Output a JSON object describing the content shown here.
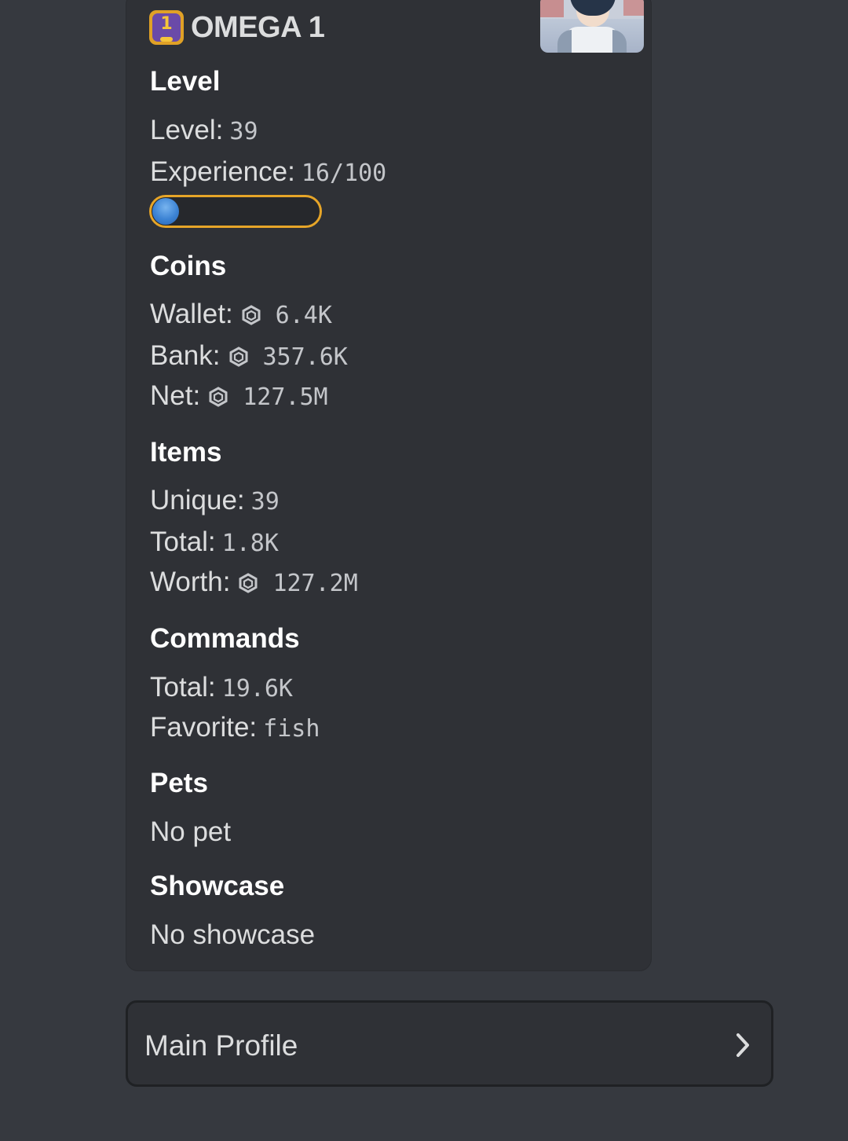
{
  "embed": {
    "title": "OMEGA 1",
    "badge_digit": "1",
    "thumbnail": "avatar-thumbnail",
    "sections": {
      "level": {
        "heading": "Level",
        "level_label": "Level:",
        "level_value": "39",
        "experience_label": "Experience:",
        "experience_value": "16/100",
        "experience_progress": 0.16
      },
      "coins": {
        "heading": "Coins",
        "wallet_label": "Wallet:",
        "wallet_value": "6.4K",
        "bank_label": "Bank:",
        "bank_value": "357.6K",
        "net_label": "Net:",
        "net_value": "127.5M",
        "coin_icon": "coin-icon"
      },
      "items": {
        "heading": "Items",
        "unique_label": "Unique:",
        "unique_value": "39",
        "total_label": "Total:",
        "total_value": "1.8K",
        "worth_label": "Worth:",
        "worth_value": "127.2M"
      },
      "commands": {
        "heading": "Commands",
        "total_label": "Total:",
        "total_value": "19.6K",
        "favorite_label": "Favorite:",
        "favorite_value": "fish"
      },
      "pets": {
        "heading": "Pets",
        "text": "No pet"
      },
      "showcase": {
        "heading": "Showcase",
        "text": "No showcase"
      }
    }
  },
  "select_menu": {
    "label": "Main Profile",
    "icon": "chevron-right-icon"
  },
  "colors": {
    "background": "#36393f",
    "embed_background": "#2f3136",
    "xp_bar_border": "#e6a528",
    "xp_bar_fill": "#3c83d4"
  }
}
